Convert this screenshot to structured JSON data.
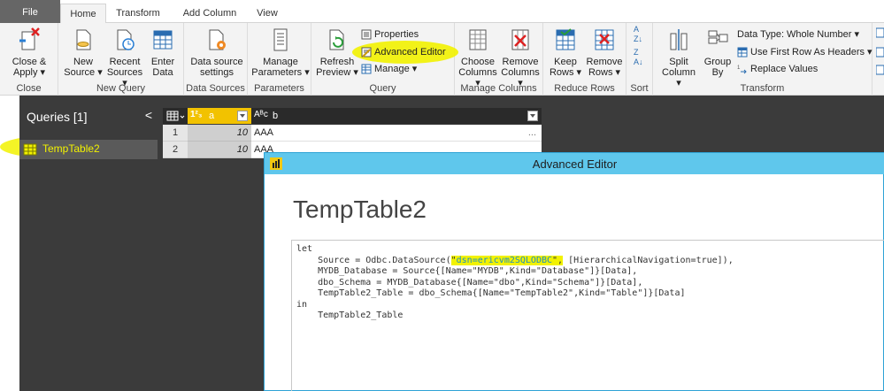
{
  "tabs": [
    "File",
    "Home",
    "Transform",
    "Add Column",
    "View"
  ],
  "ribbon": {
    "close": {
      "btn": "Close &",
      "btn2": "Apply ▾",
      "label": "Close"
    },
    "new_query": {
      "new": "New",
      "new2": "Source ▾",
      "recent": "Recent",
      "recent2": "Sources ▾",
      "enter": "Enter",
      "enter2": "Data",
      "label": "New Query"
    },
    "data_sources": {
      "btn": "Data source",
      "btn2": "settings",
      "label": "Data Sources"
    },
    "parameters": {
      "btn": "Manage",
      "btn2": "Parameters ▾",
      "label": "Parameters"
    },
    "query": {
      "refresh": "Refresh",
      "refresh2": "Preview ▾",
      "properties": "Properties",
      "advanced_editor": "Advanced Editor",
      "manage": "Manage ▾",
      "label": "Query"
    },
    "manage_columns": {
      "choose": "Choose",
      "choose2": "Columns ▾",
      "remove": "Remove",
      "remove2": "Columns ▾",
      "label": "Manage Columns"
    },
    "reduce_rows": {
      "keep": "Keep",
      "keep2": "Rows ▾",
      "remove": "Remove",
      "remove2": "Rows ▾",
      "label": "Reduce Rows"
    },
    "sort": {
      "label": "Sort"
    },
    "transform": {
      "split": "Split",
      "split2": "Column ▾",
      "group": "Group",
      "group2": "By",
      "data_type": "Data Type: Whole Number ▾",
      "first_row": "Use First Row As Headers ▾",
      "replace": "Replace Values",
      "label": "Transform"
    }
  },
  "queries": {
    "title": "Queries [1]",
    "collapse": "<",
    "items": [
      {
        "name": "TempTable2"
      }
    ]
  },
  "grid": {
    "columns": [
      {
        "type": "1²₃",
        "name": "a"
      },
      {
        "type": "Aᴮᴄ",
        "name": "b"
      }
    ],
    "rows": [
      {
        "num": "1",
        "a": "10",
        "b": "AAA",
        "more": "..."
      },
      {
        "num": "2",
        "a": "10",
        "b": "AAA"
      }
    ]
  },
  "editor": {
    "window_title": "Advanced Editor",
    "heading": "TempTable2",
    "code": {
      "l1": "let",
      "l2a": "    Source = Odbc.DataSource(",
      "l2q1": "\"",
      "l2dsn": "dsn=ericvm2SQLODBC",
      "l2q2": "\",",
      "l2b": " [HierarchicalNavigation=true]),",
      "l3": "    MYDB_Database = Source{[Name=\"MYDB\",Kind=\"Database\"]}[Data],",
      "l4": "    dbo_Schema = MYDB_Database{[Name=\"dbo\",Kind=\"Schema\"]}[Data],",
      "l5": "    TempTable2_Table = dbo_Schema{[Name=\"TempTable2\",Kind=\"Table\"]}[Data]",
      "l6": "in",
      "l7": "    TempTable2_Table"
    }
  },
  "colors": {
    "highlight": "#f2f200",
    "editor_title": "#5fc7ec",
    "pane": "#3b3b3b"
  }
}
